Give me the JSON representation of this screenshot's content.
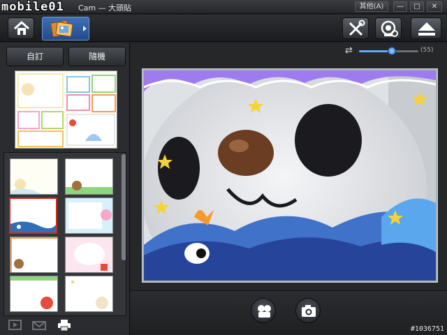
{
  "window": {
    "logo_text": "mobile01",
    "title": "Cam — 大頭貼",
    "title_prefix": "Ca"
  },
  "window_buttons": {
    "others": "其他(A)",
    "minimize": "—",
    "maximize": "□",
    "close": "✕"
  },
  "modes": {
    "custom": "自訂",
    "random": "隨機"
  },
  "zoom": {
    "value": 55,
    "label": "(55)",
    "max": 100
  },
  "icons": {
    "home": "home-icon",
    "frames": "frame-gallery-icon",
    "tools": "tools-icon",
    "webcam": "webcam-settings-icon",
    "eject": "eject-icon",
    "slideshow": "slideshow-icon",
    "email": "email-icon",
    "print": "print-icon",
    "effect": "effect-icon",
    "capture": "camera-icon"
  },
  "colors": {
    "accent": "#3f6fb6",
    "selected_border": "#d02a1e",
    "slider": "#5fa9ff"
  },
  "watermark": "#1036751"
}
